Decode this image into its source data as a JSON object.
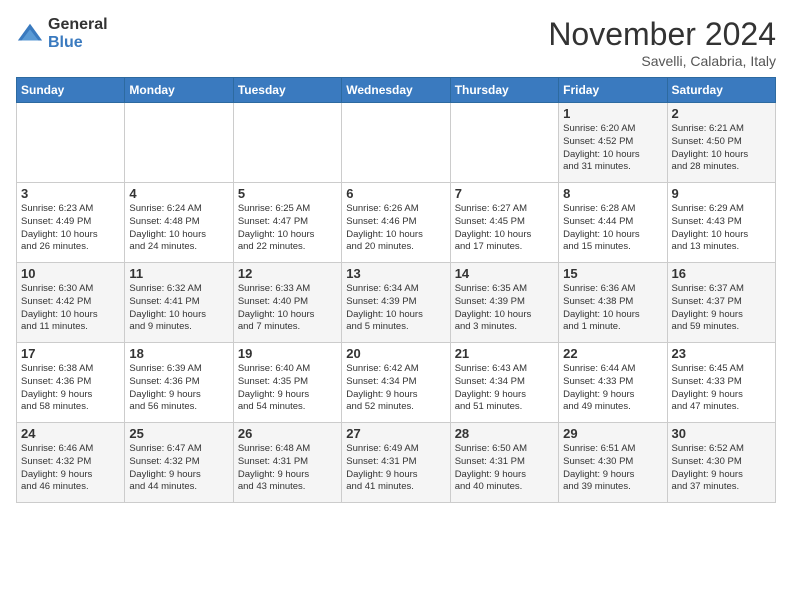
{
  "logo": {
    "general": "General",
    "blue": "Blue"
  },
  "title": "November 2024",
  "subtitle": "Savelli, Calabria, Italy",
  "days_header": [
    "Sunday",
    "Monday",
    "Tuesday",
    "Wednesday",
    "Thursday",
    "Friday",
    "Saturday"
  ],
  "weeks": [
    [
      {
        "day": "",
        "info": ""
      },
      {
        "day": "",
        "info": ""
      },
      {
        "day": "",
        "info": ""
      },
      {
        "day": "",
        "info": ""
      },
      {
        "day": "",
        "info": ""
      },
      {
        "day": "1",
        "info": "Sunrise: 6:20 AM\nSunset: 4:52 PM\nDaylight: 10 hours\nand 31 minutes."
      },
      {
        "day": "2",
        "info": "Sunrise: 6:21 AM\nSunset: 4:50 PM\nDaylight: 10 hours\nand 28 minutes."
      }
    ],
    [
      {
        "day": "3",
        "info": "Sunrise: 6:23 AM\nSunset: 4:49 PM\nDaylight: 10 hours\nand 26 minutes."
      },
      {
        "day": "4",
        "info": "Sunrise: 6:24 AM\nSunset: 4:48 PM\nDaylight: 10 hours\nand 24 minutes."
      },
      {
        "day": "5",
        "info": "Sunrise: 6:25 AM\nSunset: 4:47 PM\nDaylight: 10 hours\nand 22 minutes."
      },
      {
        "day": "6",
        "info": "Sunrise: 6:26 AM\nSunset: 4:46 PM\nDaylight: 10 hours\nand 20 minutes."
      },
      {
        "day": "7",
        "info": "Sunrise: 6:27 AM\nSunset: 4:45 PM\nDaylight: 10 hours\nand 17 minutes."
      },
      {
        "day": "8",
        "info": "Sunrise: 6:28 AM\nSunset: 4:44 PM\nDaylight: 10 hours\nand 15 minutes."
      },
      {
        "day": "9",
        "info": "Sunrise: 6:29 AM\nSunset: 4:43 PM\nDaylight: 10 hours\nand 13 minutes."
      }
    ],
    [
      {
        "day": "10",
        "info": "Sunrise: 6:30 AM\nSunset: 4:42 PM\nDaylight: 10 hours\nand 11 minutes."
      },
      {
        "day": "11",
        "info": "Sunrise: 6:32 AM\nSunset: 4:41 PM\nDaylight: 10 hours\nand 9 minutes."
      },
      {
        "day": "12",
        "info": "Sunrise: 6:33 AM\nSunset: 4:40 PM\nDaylight: 10 hours\nand 7 minutes."
      },
      {
        "day": "13",
        "info": "Sunrise: 6:34 AM\nSunset: 4:39 PM\nDaylight: 10 hours\nand 5 minutes."
      },
      {
        "day": "14",
        "info": "Sunrise: 6:35 AM\nSunset: 4:39 PM\nDaylight: 10 hours\nand 3 minutes."
      },
      {
        "day": "15",
        "info": "Sunrise: 6:36 AM\nSunset: 4:38 PM\nDaylight: 10 hours\nand 1 minute."
      },
      {
        "day": "16",
        "info": "Sunrise: 6:37 AM\nSunset: 4:37 PM\nDaylight: 9 hours\nand 59 minutes."
      }
    ],
    [
      {
        "day": "17",
        "info": "Sunrise: 6:38 AM\nSunset: 4:36 PM\nDaylight: 9 hours\nand 58 minutes."
      },
      {
        "day": "18",
        "info": "Sunrise: 6:39 AM\nSunset: 4:36 PM\nDaylight: 9 hours\nand 56 minutes."
      },
      {
        "day": "19",
        "info": "Sunrise: 6:40 AM\nSunset: 4:35 PM\nDaylight: 9 hours\nand 54 minutes."
      },
      {
        "day": "20",
        "info": "Sunrise: 6:42 AM\nSunset: 4:34 PM\nDaylight: 9 hours\nand 52 minutes."
      },
      {
        "day": "21",
        "info": "Sunrise: 6:43 AM\nSunset: 4:34 PM\nDaylight: 9 hours\nand 51 minutes."
      },
      {
        "day": "22",
        "info": "Sunrise: 6:44 AM\nSunset: 4:33 PM\nDaylight: 9 hours\nand 49 minutes."
      },
      {
        "day": "23",
        "info": "Sunrise: 6:45 AM\nSunset: 4:33 PM\nDaylight: 9 hours\nand 47 minutes."
      }
    ],
    [
      {
        "day": "24",
        "info": "Sunrise: 6:46 AM\nSunset: 4:32 PM\nDaylight: 9 hours\nand 46 minutes."
      },
      {
        "day": "25",
        "info": "Sunrise: 6:47 AM\nSunset: 4:32 PM\nDaylight: 9 hours\nand 44 minutes."
      },
      {
        "day": "26",
        "info": "Sunrise: 6:48 AM\nSunset: 4:31 PM\nDaylight: 9 hours\nand 43 minutes."
      },
      {
        "day": "27",
        "info": "Sunrise: 6:49 AM\nSunset: 4:31 PM\nDaylight: 9 hours\nand 41 minutes."
      },
      {
        "day": "28",
        "info": "Sunrise: 6:50 AM\nSunset: 4:31 PM\nDaylight: 9 hours\nand 40 minutes."
      },
      {
        "day": "29",
        "info": "Sunrise: 6:51 AM\nSunset: 4:30 PM\nDaylight: 9 hours\nand 39 minutes."
      },
      {
        "day": "30",
        "info": "Sunrise: 6:52 AM\nSunset: 4:30 PM\nDaylight: 9 hours\nand 37 minutes."
      }
    ]
  ]
}
